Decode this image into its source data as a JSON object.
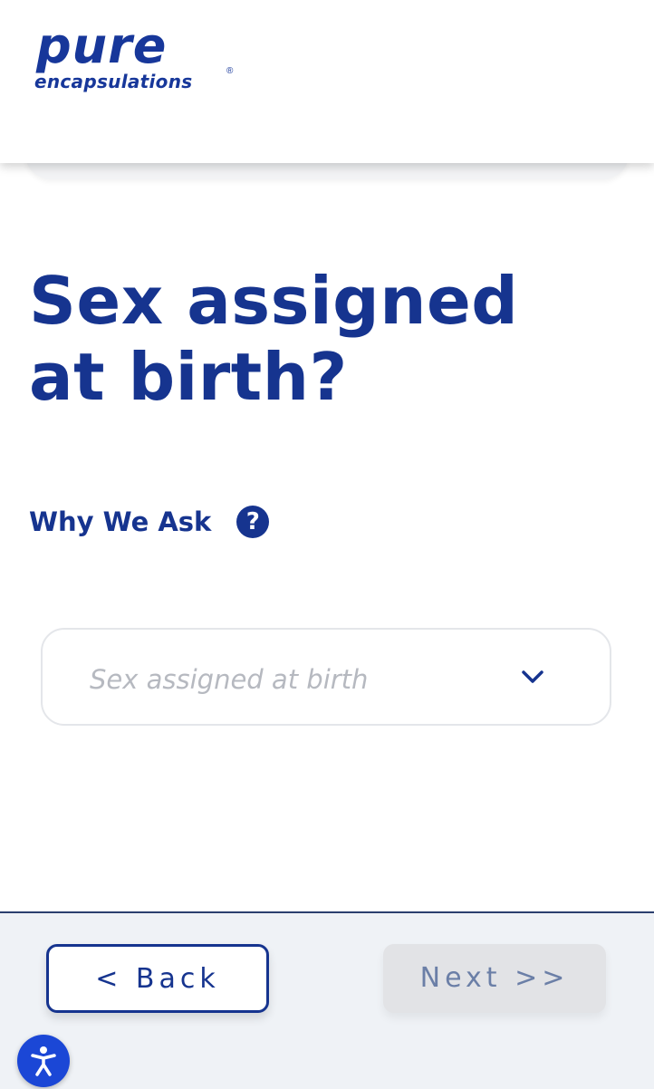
{
  "header": {
    "logo_word": "pure",
    "logo_sub": "encapsulations",
    "logo_reg": "®"
  },
  "question": {
    "title": "Sex assigned at birth?"
  },
  "why_we_ask": {
    "label": "Why We Ask",
    "icon": "help-circle-icon",
    "icon_glyph": "?"
  },
  "select": {
    "placeholder": "Sex assigned at birth",
    "icon": "chevron-down-icon"
  },
  "footer": {
    "back_label": "< Back",
    "next_label": "Next >>"
  },
  "accessibility": {
    "icon": "accessibility-icon"
  },
  "colors": {
    "brand_navy": "#16348f",
    "accessibility_blue": "#1b47d6",
    "disabled_button": "#e2e3e6"
  }
}
